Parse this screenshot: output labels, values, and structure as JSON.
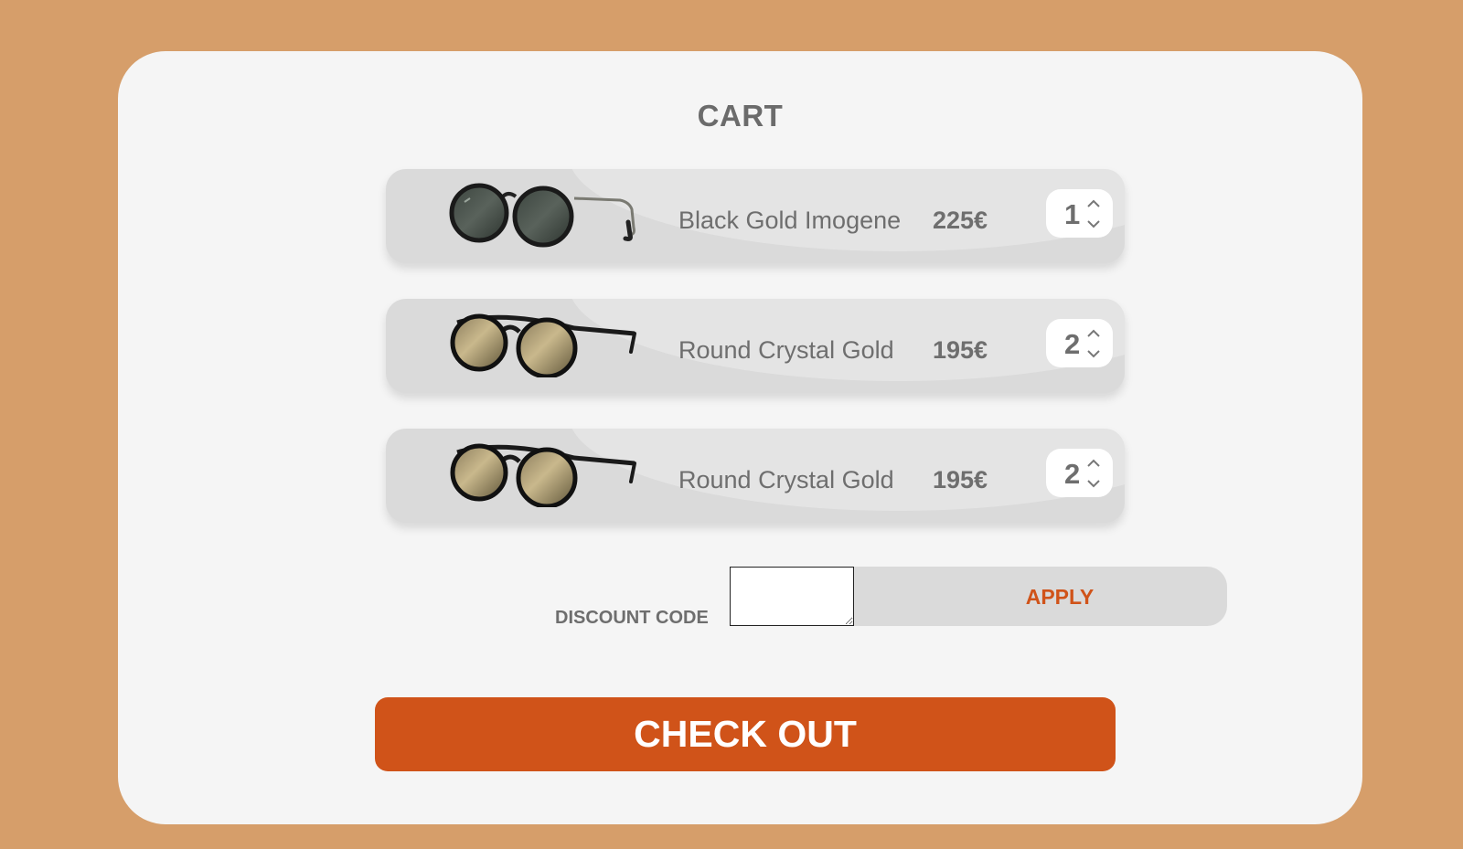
{
  "colors": {
    "background": "#d69e6a",
    "card": "#f5f5f5",
    "item_bg": "#dadada",
    "accent": "#d05319",
    "text": "#6e6e6e"
  },
  "cart": {
    "title": "CART",
    "items": [
      {
        "name": "Black Gold Imogene",
        "price": "225€",
        "quantity": "1",
        "image_icon": "dark-lens-round-sunglasses-icon"
      },
      {
        "name": "Round Crystal Gold",
        "price": "195€",
        "quantity": "2",
        "image_icon": "gold-lens-round-sunglasses-icon"
      },
      {
        "name": "Round Crystal Gold",
        "price": "195€",
        "quantity": "2",
        "image_icon": "gold-lens-round-sunglasses-icon"
      }
    ]
  },
  "discount": {
    "label": "DISCOUNT CODE",
    "value": "",
    "apply_label": "APPLY"
  },
  "checkout": {
    "label": "CHECK OUT"
  }
}
